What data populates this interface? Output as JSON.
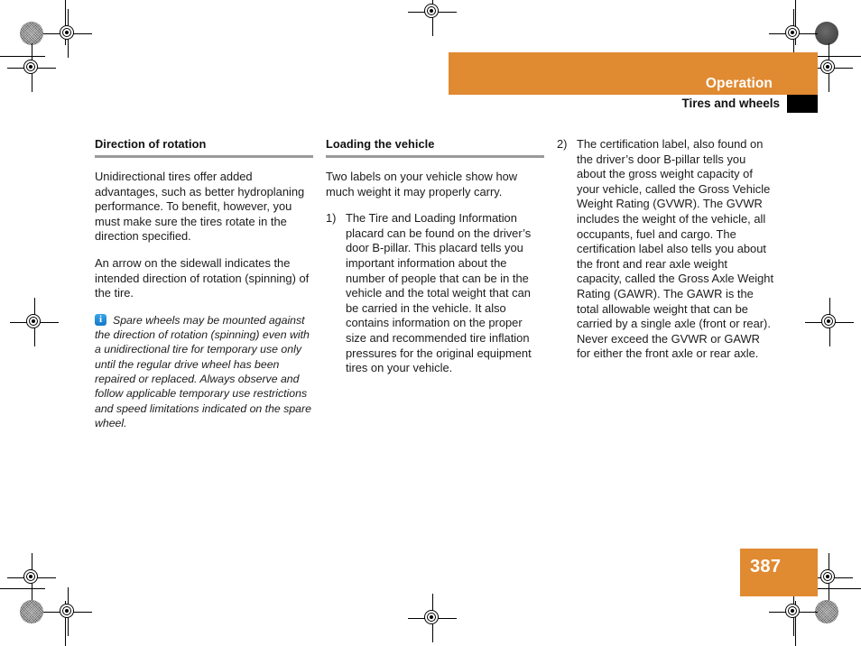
{
  "page": {
    "number": "387",
    "chapter": "Operation",
    "section": "Tires and wheels",
    "accent_color": "#e08a32",
    "rule_color": "#9a9a9a",
    "info_icon_color": "#1478c8"
  },
  "columns": [
    {
      "heading": "Direction of rotation",
      "paragraphs": [
        "Unidirectional tires offer added advantages, such as better hydroplaning performance. To benefit, however, you must make sure the tires rotate in the direction specified.",
        "An arrow on the sidewall indicates the intended direction of rotation (spinning) of the tire."
      ],
      "note": {
        "icon": "info-icon",
        "text": "Spare wheels may be mounted against the direction of rotation (spinning) even with a unidirectional tire for temporary use only until the regular drive wheel has been repaired or replaced. Always observe and follow applicable temporary use restrictions and speed limitations indicated on the spare wheel."
      }
    },
    {
      "heading": "Loading the vehicle",
      "paragraphs": [
        "Two labels on your vehicle show how much weight it may properly carry."
      ],
      "list": [
        {
          "marker": "1)",
          "text": "The Tire and Loading Information placard can be found on the driver’s door B-pillar. This placard tells you important information about the number of people that can be in the vehicle and the total weight that can be carried in the vehicle. It also contains information on the proper size and recommended tire inflation pressures for the original equipment tires on your vehicle."
        }
      ]
    },
    {
      "heading": "",
      "paragraphs": [],
      "list": [
        {
          "marker": "2)",
          "text": "The certification label, also found on the driver’s door B-pillar tells you about the gross weight capacity of your vehicle, called the Gross Vehicle Weight Rating (GVWR). The GVWR includes the weight of the vehicle, all occupants, fuel and cargo. The certification label also tells you about the front and rear axle weight capacity, called the Gross Axle Weight Rating (GAWR). The GAWR is the total allowable weight that can be carried by a single axle (front or rear). Never exceed the GVWR or GAWR for either the front axle or rear axle."
        }
      ]
    }
  ]
}
